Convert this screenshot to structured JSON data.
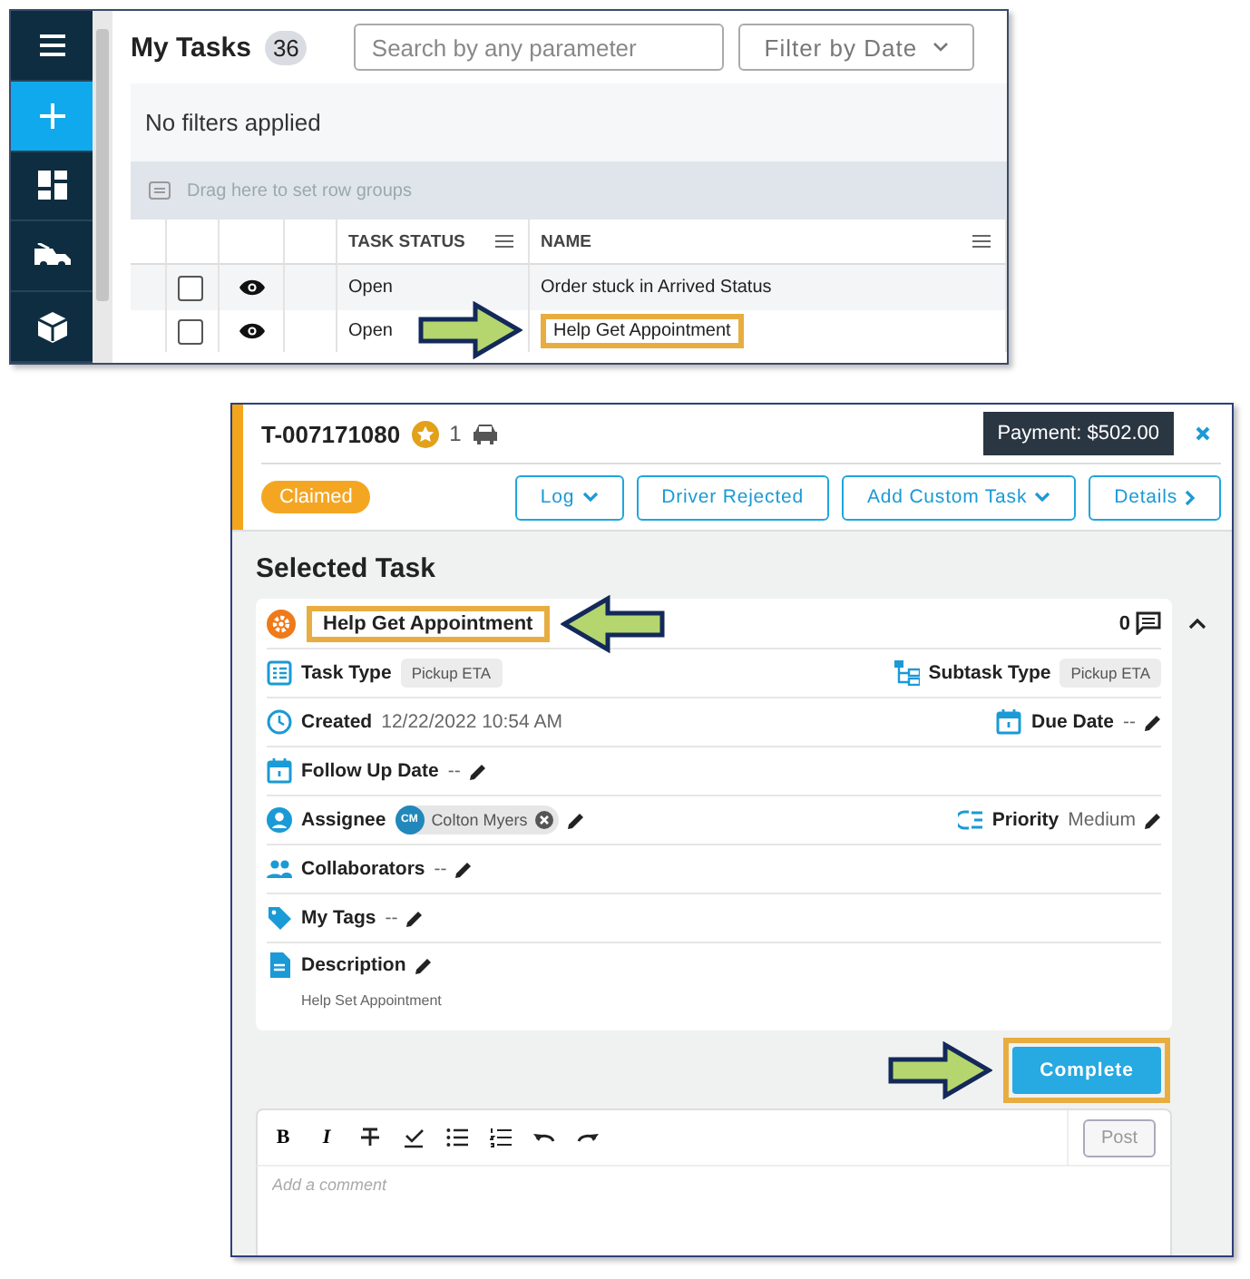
{
  "task_list": {
    "sidebar": [
      {
        "kind": "menu",
        "selected": false
      },
      {
        "kind": "plus",
        "selected": true
      },
      {
        "kind": "dashboard",
        "selected": false
      },
      {
        "kind": "truck",
        "selected": false
      },
      {
        "kind": "box",
        "selected": false
      }
    ],
    "title": "My Tasks",
    "count": "36",
    "search": {
      "placeholder": "Search by any parameter"
    },
    "date_filter": "Filter by Date",
    "filter_status": "No filters applied",
    "group_hint": "Drag here to set row groups",
    "columns": [
      {
        "label": "TASK STATUS"
      },
      {
        "label": "NAME"
      }
    ],
    "rows": [
      {
        "checked": false,
        "status": "Open",
        "name": "Order stuck in Arrived Status",
        "highlighted": false
      },
      {
        "checked": false,
        "status": "Open",
        "name": "Help Get Appointment",
        "highlighted": true
      }
    ]
  },
  "task_detail": {
    "ticket": "T-007171080",
    "vehicle_count": "1",
    "payment": "Payment: $502.00",
    "status": "Claimed",
    "actions": [
      {
        "label": "Log",
        "kind": "dropdown"
      },
      {
        "label": "Driver Rejected",
        "kind": "plain"
      },
      {
        "label": "Add Custom Task",
        "kind": "dropdown"
      },
      {
        "label": "Details",
        "kind": "link"
      }
    ],
    "section_title": "Selected Task",
    "task_name": "Help Get Appointment",
    "task_name_highlighted": true,
    "comment_count": "0",
    "rows": [
      {
        "left": {
          "kind": "list",
          "label": "Task Type",
          "chip": "Pickup ETA",
          "editable": false
        },
        "right": {
          "kind": "tree",
          "label": "Subtask Type",
          "chip": "Pickup ETA",
          "editable": false
        }
      },
      {
        "left": {
          "kind": "clock",
          "label": "Created",
          "value": "12/22/2022 10:54 AM",
          "editable": false
        },
        "right": {
          "kind": "calendar",
          "label": "Due Date",
          "value": "--",
          "editable": true
        }
      },
      {
        "left": {
          "kind": "calendar",
          "label": "Follow Up Date",
          "value": "--",
          "editable": true
        }
      },
      {
        "left": {
          "kind": "person",
          "label": "Assignee",
          "assignee": {
            "initials": "CM",
            "name": "Colton Myers"
          },
          "editable": true
        },
        "right": {
          "kind": "priority",
          "label": "Priority",
          "value": "Medium",
          "editable": true
        }
      },
      {
        "left": {
          "kind": "people",
          "label": "Collaborators",
          "value": "--",
          "editable": true
        }
      },
      {
        "left": {
          "kind": "tag",
          "label": "My Tags",
          "value": "--",
          "editable": true
        }
      },
      {
        "left": {
          "kind": "doc",
          "label": "Description",
          "editable": true,
          "note": "Help Set Appointment"
        }
      }
    ],
    "complete": {
      "label": "Complete",
      "highlighted": true
    },
    "editor": {
      "tools": [
        {
          "kind": "bold",
          "label": "B"
        },
        {
          "kind": "italic",
          "label": "I"
        },
        {
          "kind": "strike"
        },
        {
          "kind": "check"
        },
        {
          "kind": "bullets"
        },
        {
          "kind": "numbers"
        },
        {
          "kind": "undo"
        },
        {
          "kind": "redo"
        }
      ],
      "post": "Post",
      "placeholder": "Add a comment"
    }
  }
}
